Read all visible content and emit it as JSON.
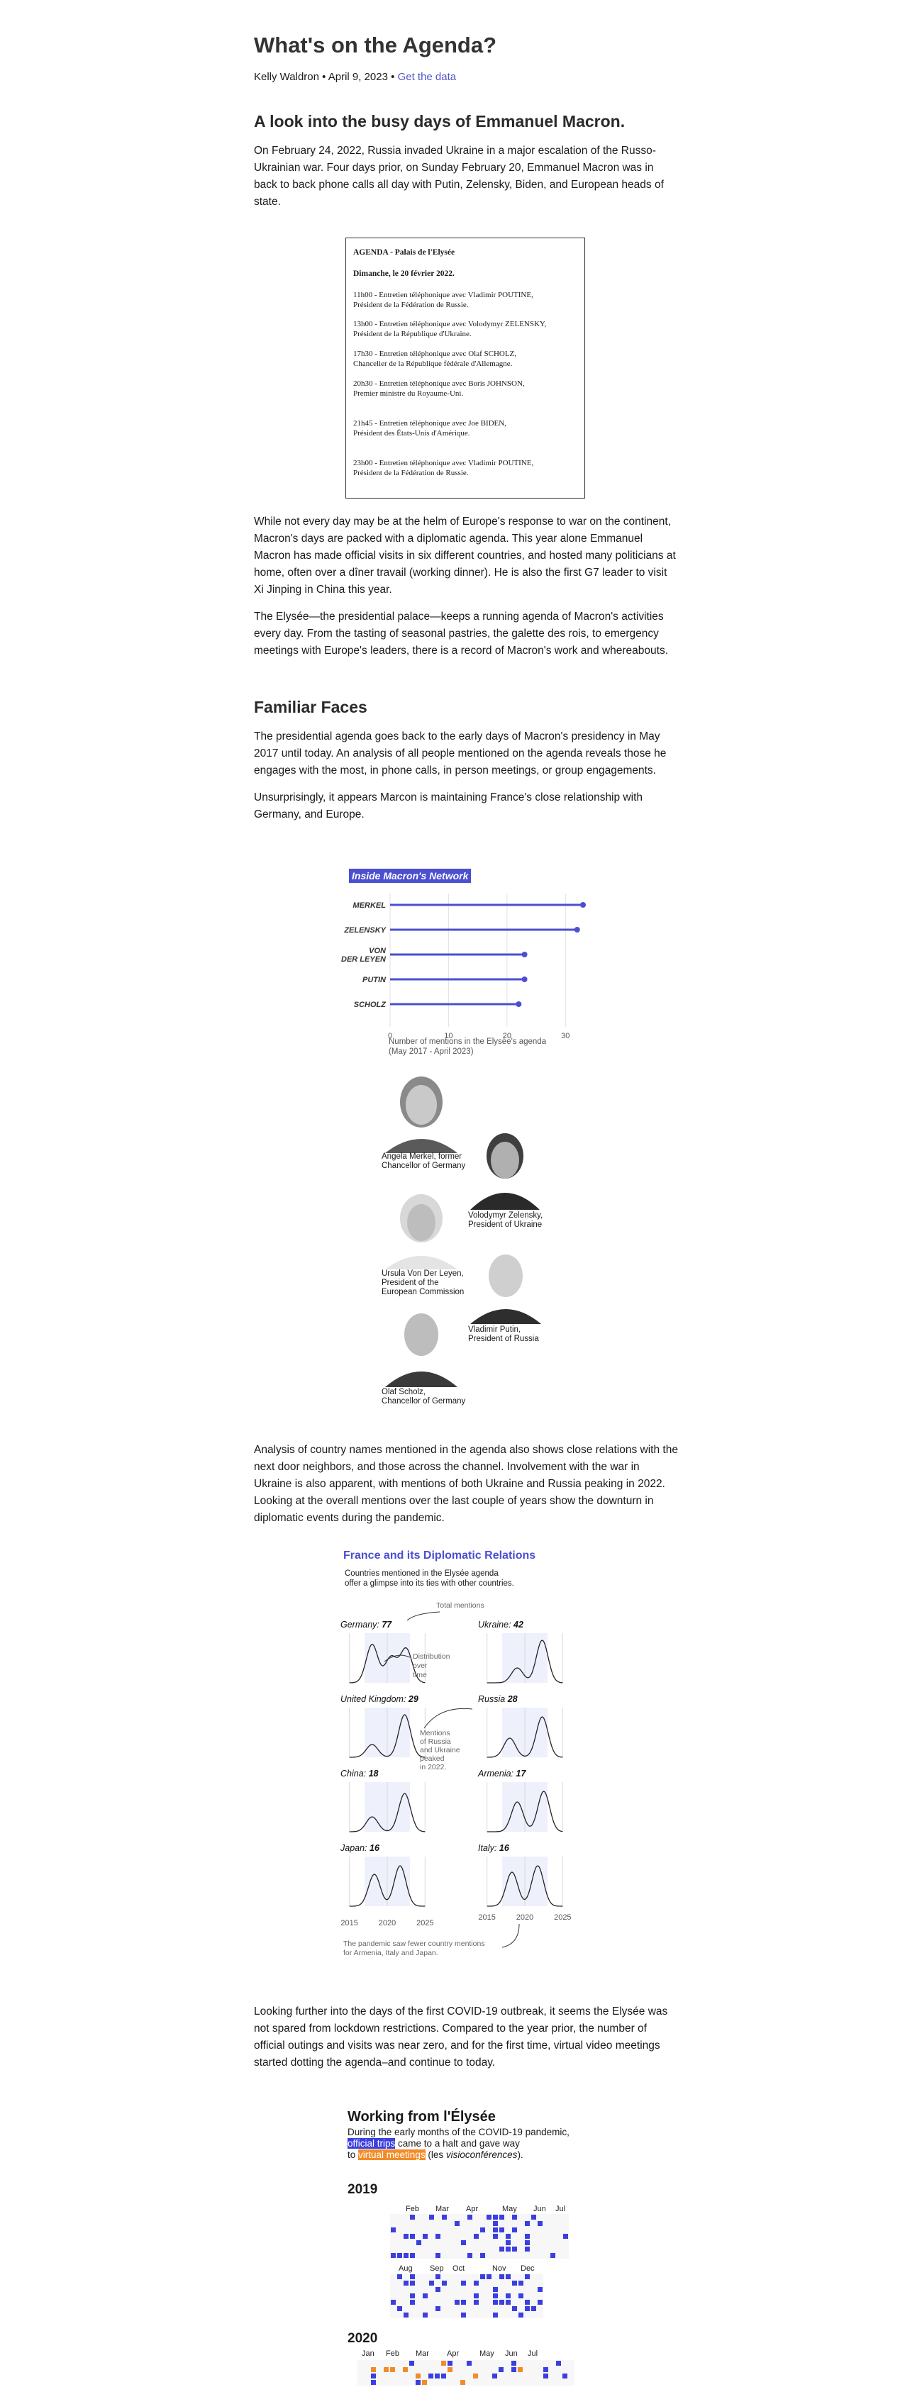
{
  "header": {
    "title": "What's on the Agenda?",
    "byline_prefix": "Kelly Waldron • April 9, 2023 •",
    "get_data": "Get the data"
  },
  "intro": {
    "heading": "A look into the busy days of Emmanuel Macron.",
    "p1": "On February 24, 2022, Russia invaded Ukraine in a major escalation of the Russo-Ukrainian war. Four days prior, on Sunday February 20, Emmanuel Macron was in back to back phone calls all day with Putin, Zelensky, Biden, and European heads of state.",
    "p2": "While not every day may be at the helm of Europe's response to war on the continent, Macron's days are packed with a diplomatic agenda. This year alone Emmanuel Macron has made official visits in six different countries, and hosted many politicians at home, often over a dîner travail (working dinner). He is also the first G7 leader to visit Xi Jinping in China this year.",
    "p3": "The Elysée—the presidential palace—keeps a running agenda of Macron's activities every day. From the tasting of seasonal pastries, the galette des rois, to emergency meetings with Europe's leaders, there is a record of Macron's work and whereabouts."
  },
  "agenda": {
    "title": "AGENDA - Palais de l'Elysée",
    "date": "Dimanche, le 20 février 2022.",
    "entries": [
      {
        "l1": "11h00 - Entretien téléphonique avec Vladimir POUTINE,",
        "l2": "Président de la Fédération de Russie."
      },
      {
        "l1": "13h00 - Entretien téléphonique avec Volodymyr ZELENSKY,",
        "l2": "Président de la République d'Ukraine."
      },
      {
        "l1": "17h30 - Entretien téléphonique avec Olaf SCHOLZ,",
        "l2": "Chancelier de la République fédérale d'Allemagne."
      },
      {
        "l1": "20h30 - Entretien téléphonique avec Boris JOHNSON,",
        "l2": "Premier ministre du Royaume-Uni."
      },
      {
        "l1": "21h45 - Entretien téléphonique avec Joe BIDEN,",
        "l2": "Président des États-Unis d'Amérique."
      },
      {
        "l1": "23h00 - Entretien téléphonique avec Vladimir POUTINE,",
        "l2": "Président de la Fédération de Russie."
      }
    ]
  },
  "faces": {
    "heading": "Familiar Faces",
    "p1": "The presidential agenda goes back to the early days of Macron's presidency in May 2017 until today. An analysis of all people mentioned on the agenda reveals those he engages with the most, in phone calls, in person meetings, or group engagements.",
    "p2": "Unsurprisingly, it appears Marcon is maintaining France's close relationship with Germany, and Europe."
  },
  "network": {
    "title": "Inside Macron's Network",
    "caption_l1": "Number of mentions in the Elysée's agenda",
    "caption_l2": "(May 2017 - April 2023)"
  },
  "chart_data": [
    {
      "type": "bar",
      "title": "Inside Macron's Network",
      "categories": [
        "MERKEL",
        "ZELENSKY",
        "VON DER LEYEN",
        "PUTIN",
        "SCHOLZ"
      ],
      "values": [
        33,
        32,
        23,
        23,
        22
      ],
      "xlabel": "Number of mentions in the Elysée's agenda (May 2017 - April 2023)",
      "xlim": [
        0,
        33
      ],
      "xticks": [
        0,
        10,
        20,
        30
      ],
      "grid": true
    },
    {
      "type": "area",
      "title": "France and its Diplomatic Relations",
      "series": [
        {
          "name": "Germany",
          "total": 77
        },
        {
          "name": "Ukraine",
          "total": 42
        },
        {
          "name": "United Kingdom",
          "total": 29
        },
        {
          "name": "Russia",
          "total": 28
        },
        {
          "name": "China",
          "total": 18
        },
        {
          "name": "Armenia",
          "total": 17
        },
        {
          "name": "Japan",
          "total": 16
        },
        {
          "name": "Italy",
          "total": 16
        }
      ],
      "xticks": [
        2015,
        2020,
        2025
      ]
    }
  ],
  "portraits": [
    {
      "l1": "Angela Merkel, former",
      "l2": "Chancellor of Germany",
      "l3": ""
    },
    {
      "l1": "Volodymyr Zelensky,",
      "l2": "President of Ukraine",
      "l3": ""
    },
    {
      "l1": "Ursula Von Der Leyen,",
      "l2": "President of the",
      "l3": "European Commission"
    },
    {
      "l1": "Vladimir Putin,",
      "l2": "President of Russia",
      "l3": ""
    },
    {
      "l1": "Olaf Scholz,",
      "l2": "Chancellor of Germany",
      "l3": ""
    }
  ],
  "countries_text": "Analysis of country names mentioned in the agenda also shows close relations with the next door neighbors, and those across the channel. Involvement with the war in Ukraine is also apparent, with mentions of both Ukraine and Russia peaking in 2022. Looking at the overall mentions over the last couple of years show the downturn in diplomatic events during the pandemic.",
  "relations": {
    "title": "France and its Diplomatic Relations",
    "sub_l1": "Countries mentioned in the Elysée agenda",
    "sub_l2": "offer a glimpse into its ties with other countries.",
    "ann_total": "Total mentions",
    "ann_dist_l1": "Distribution",
    "ann_dist_l2": "over",
    "ann_dist_l3": "time",
    "ann_ru_l1": "Mentions",
    "ann_ru_l2": "of Russia",
    "ann_ru_l3": "and Ukraine",
    "ann_ru_l4": "peaked",
    "ann_ru_l5": "in 2022.",
    "ann_pandemic_l1": "The pandemic saw fewer country mentions",
    "ann_pandemic_l2": "for Armenia, Italy and Japan.",
    "countries": [
      {
        "name": "Germany:",
        "total": "77"
      },
      {
        "name": "Ukraine:",
        "total": "42"
      },
      {
        "name": "United Kingdom:",
        "total": "29"
      },
      {
        "name": "Russia",
        "total": "28"
      },
      {
        "name": "China:",
        "total": "18"
      },
      {
        "name": "Armenia:",
        "total": "17"
      },
      {
        "name": "Japan:",
        "total": "16"
      },
      {
        "name": "Italy:",
        "total": "16"
      }
    ],
    "ticks": [
      "2015",
      "2020",
      "2025"
    ]
  },
  "covid_text": "Looking further into the days of the first COVID-19 outbreak, it seems the Elysée was not spared from lockdown restrictions. Compared to the year prior, the number of official outings and visits was near zero, and for the first time, virtual video meetings started dotting the agenda–and continue to today.",
  "working": {
    "title": "Working from l'Élysée",
    "l1": "During the early months of the COVID-19 pandemic,",
    "blue": "official trips",
    "l2a": "came to a halt and gave way",
    "l3a": "to",
    "orange": "virtual meetings",
    "l3b": "(les",
    "l3c": "visioconférences",
    "l3d": ").",
    "y2019": "2019",
    "y2020": "2020",
    "months_2019_a": [
      "Feb",
      "Mar",
      "Apr",
      "May",
      "Jun",
      "Jul"
    ],
    "months_2019_b": [
      "Aug",
      "Sep",
      "Oct",
      "Nov",
      "Dec"
    ],
    "months_2020": [
      "Jan",
      "Feb",
      "Mar",
      "Apr",
      "May",
      "Jun",
      "Jul"
    ]
  },
  "colors": {
    "accent": "#4b4fd0",
    "trip": "#3b3fe0",
    "virtual": "#f28c28"
  }
}
